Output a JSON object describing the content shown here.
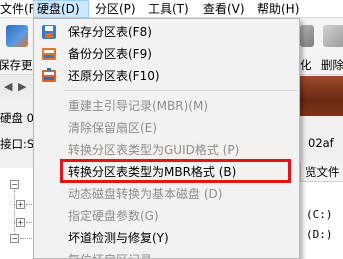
{
  "menubar": {
    "items": [
      "文件(F)",
      "硬盘(D)",
      "分区(P)",
      "工具(T)",
      "查看(V)",
      "帮助(H)"
    ]
  },
  "toolbar": {
    "buttons": [
      {
        "label": "保存更改",
        "icon": "save-changes-icon"
      },
      {
        "label": "化",
        "icon": "format-icon"
      },
      {
        "label": "删除",
        "icon": "delete-icon"
      }
    ]
  },
  "left_panel": {
    "disk_label": "硬盘 0",
    "interface_label": "接口:S"
  },
  "right_panel": {
    "signature": "02af",
    "tab_label": "览文件",
    "drive_c": "(C:)",
    "drive_d": "(D:)"
  },
  "dropdown": {
    "items": [
      {
        "label": "保存分区表(F8)",
        "enabled": true,
        "icon": "save-partition-table-icon"
      },
      {
        "label": "备份分区表(F9)",
        "enabled": true,
        "icon": "backup-partition-table-icon"
      },
      {
        "label": "还原分区表(F10)",
        "enabled": true,
        "icon": "restore-partition-table-icon"
      },
      {
        "label": "重建主引导记录(MBR)(M)",
        "enabled": false
      },
      {
        "label": "清除保留扇区(E)",
        "enabled": false
      },
      {
        "label": "转换分区表类型为GUID格式 (P)",
        "enabled": false
      },
      {
        "label": "转换分区表类型为MBR格式 (B)",
        "enabled": true,
        "highlighted": true
      },
      {
        "label": "动态磁盘转换为基本磁盘 (D)",
        "enabled": false
      },
      {
        "label": "指定硬盘参数(G)",
        "enabled": false
      },
      {
        "label": "坏道检测与修复(Y)",
        "enabled": true
      },
      {
        "label": "复位坏扇区记录",
        "enabled": false
      }
    ]
  },
  "colors": {
    "highlight_border": "#e3141a",
    "disabled_text": "#8d8d8d",
    "menu_active_bg": "#cce8ff"
  }
}
